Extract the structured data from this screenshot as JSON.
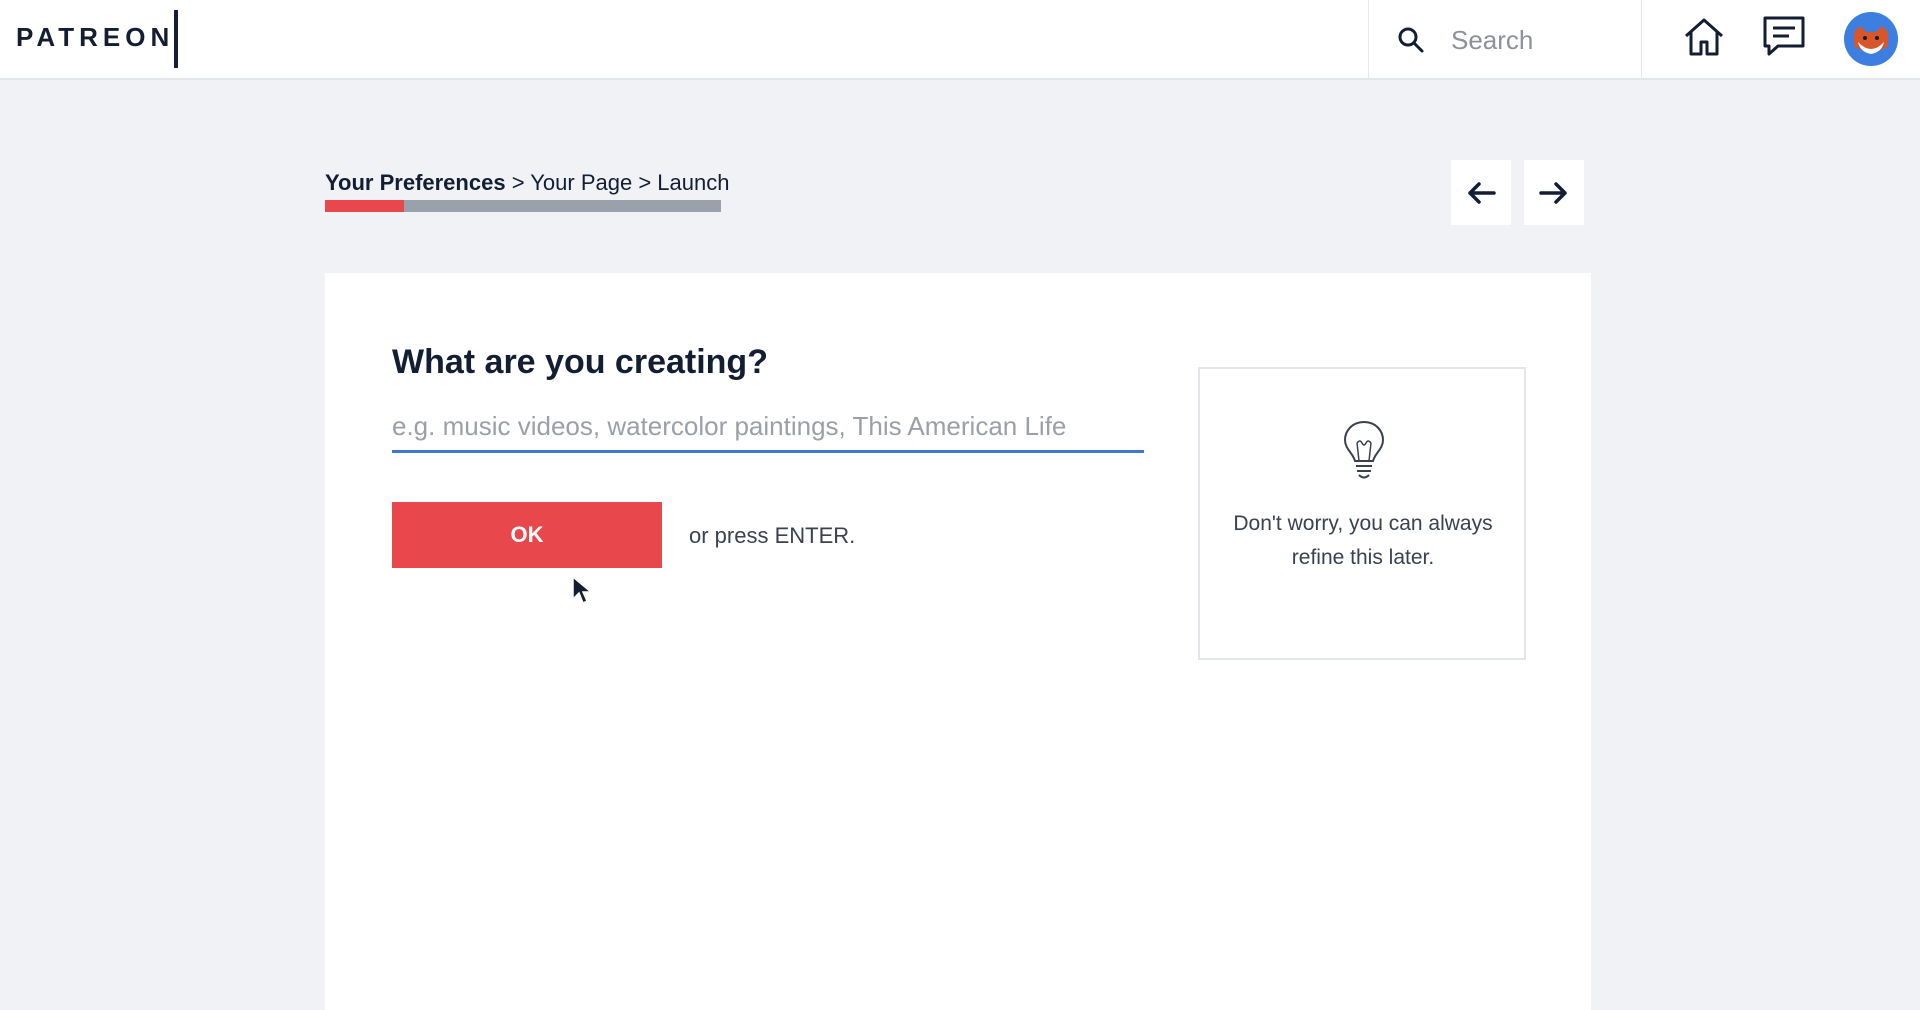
{
  "header": {
    "logo": "PATREON",
    "search": {
      "placeholder": "Search",
      "value": ""
    }
  },
  "breadcrumb": {
    "steps": [
      "Your Preferences",
      "Your Page",
      "Launch"
    ],
    "separator": " > ",
    "current_index": 0,
    "progress_fraction": 0.2
  },
  "form": {
    "question": "What are you creating?",
    "input": {
      "placeholder": "e.g. music videos, watercolor paintings, This American Life",
      "value": ""
    },
    "ok_label": "OK",
    "hint": "or press ENTER."
  },
  "tip": {
    "icon": "lightbulb-icon",
    "text": "Don't worry, you can always refine this later."
  },
  "colors": {
    "accent": "#e8474c",
    "input_focus": "#3c78d8",
    "avatar_bg": "#3d7fe0",
    "text_dark": "#141e32"
  }
}
